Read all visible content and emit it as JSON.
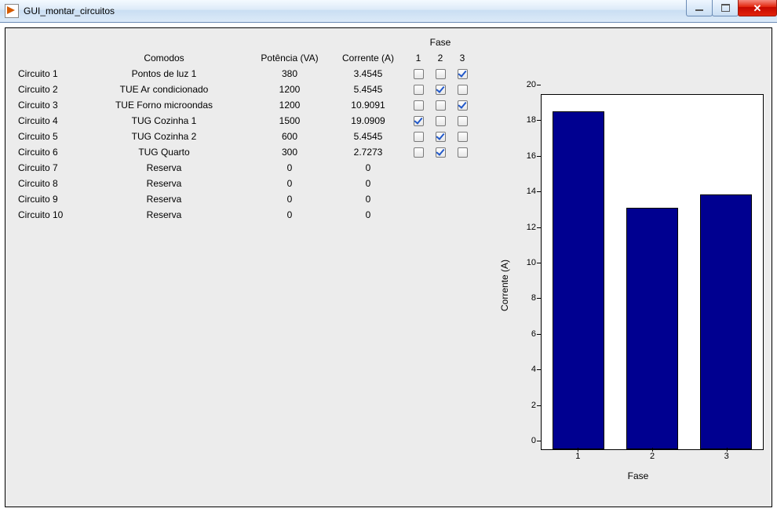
{
  "window": {
    "title": "GUI_montar_circuitos"
  },
  "table": {
    "header_fase": "Fase",
    "headers": {
      "circuito": "",
      "comodos": "Comodos",
      "potencia": "Potência (VA)",
      "corrente": "Corrente (A)",
      "f1": "1",
      "f2": "2",
      "f3": "3"
    },
    "rows": [
      {
        "name": "Circuito 1",
        "comodo": "Pontos de luz 1",
        "pot": "380",
        "corr": "3.4545",
        "fase": [
          false,
          false,
          true
        ]
      },
      {
        "name": "Circuito 2",
        "comodo": "TUE Ar condicionado",
        "pot": "1200",
        "corr": "5.4545",
        "fase": [
          false,
          true,
          false
        ]
      },
      {
        "name": "Circuito 3",
        "comodo": "TUE Forno microondas",
        "pot": "1200",
        "corr": "10.9091",
        "fase": [
          false,
          false,
          true
        ]
      },
      {
        "name": "Circuito 4",
        "comodo": "TUG Cozinha 1",
        "pot": "1500",
        "corr": "19.0909",
        "fase": [
          true,
          false,
          false
        ]
      },
      {
        "name": "Circuito 5",
        "comodo": "TUG Cozinha 2",
        "pot": "600",
        "corr": "5.4545",
        "fase": [
          false,
          true,
          false
        ]
      },
      {
        "name": "Circuito 6",
        "comodo": "TUG Quarto",
        "pot": "300",
        "corr": "2.7273",
        "fase": [
          false,
          true,
          false
        ]
      },
      {
        "name": "Circuito 7",
        "comodo": "Reserva",
        "pot": "0",
        "corr": "0",
        "fase": null
      },
      {
        "name": "Circuito 8",
        "comodo": "Reserva",
        "pot": "0",
        "corr": "0",
        "fase": null
      },
      {
        "name": "Circuito 9",
        "comodo": "Reserva",
        "pot": "0",
        "corr": "0",
        "fase": null
      },
      {
        "name": "Circuito 10",
        "comodo": "Reserva",
        "pot": "0",
        "corr": "0",
        "fase": null
      }
    ]
  },
  "chart_data": {
    "type": "bar",
    "categories": [
      "1",
      "2",
      "3"
    ],
    "values": [
      19.09,
      13.64,
      14.36
    ],
    "xlabel": "Fase",
    "ylabel": "Corrente (A)",
    "ylim": [
      0,
      20
    ],
    "yticks": [
      0,
      2,
      4,
      6,
      8,
      10,
      12,
      14,
      16,
      18,
      20
    ],
    "bar_color": "#000090"
  }
}
